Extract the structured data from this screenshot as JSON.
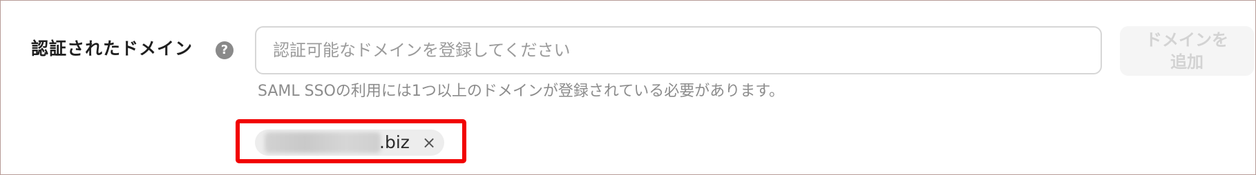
{
  "domain_field": {
    "label": "認証されたドメイン",
    "help_icon": "?",
    "input_value": "",
    "input_placeholder": "認証可能なドメインを登録してください",
    "add_button_label": "ドメインを追加",
    "helper_text": "SAML SSOの利用には1つ以上のドメインが登録されている必要があります。"
  },
  "registered_domains": [
    {
      "visible_suffix": ".biz",
      "remove_icon": "×"
    }
  ],
  "colors": {
    "highlight": "#f20000",
    "chip_background": "#ededed",
    "button_disabled_background": "#f5f5f5",
    "button_disabled_text": "#d3d3d3"
  }
}
